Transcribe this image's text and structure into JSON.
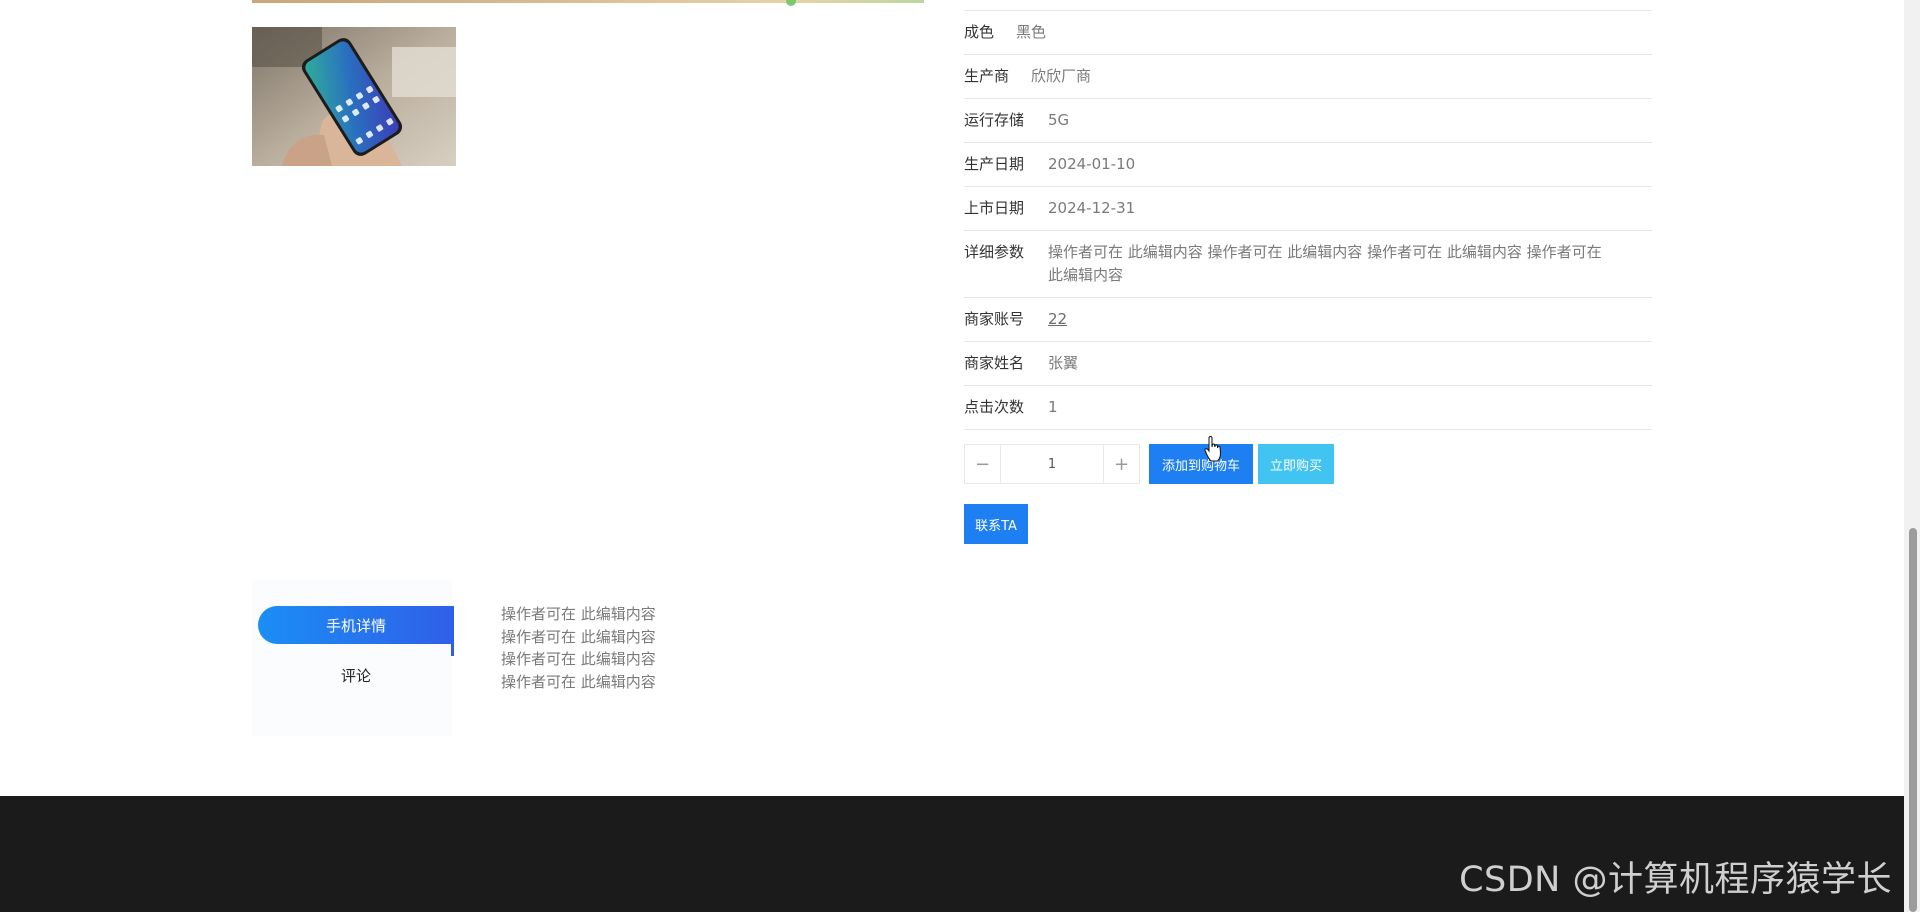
{
  "details": [
    {
      "label": "成色",
      "value": "黑色"
    },
    {
      "label": "生产商",
      "value": "欣欣厂商"
    },
    {
      "label": "运行存储",
      "value": "5G"
    },
    {
      "label": "生产日期",
      "value": "2024-01-10"
    },
    {
      "label": "上市日期",
      "value": "2024-12-31"
    },
    {
      "label": "详细参数",
      "value_line1": "操作者可在 此编辑内容 操作者可在 此编辑内容 操作者可在 此编辑内容 操作者可在",
      "value_line2": "此编辑内容"
    },
    {
      "label": "商家账号",
      "value": "22"
    },
    {
      "label": "商家姓名",
      "value": "张翼"
    },
    {
      "label": "点击次数",
      "value": "1"
    }
  ],
  "quantity": {
    "value": "1",
    "minus": "−",
    "plus": "+"
  },
  "buttons": {
    "add_to_cart": "添加到购物车",
    "buy_now": "立即购买",
    "contact": "联系TA"
  },
  "tabs": {
    "active": "手机详情",
    "inactive": "评论"
  },
  "tab_content": [
    "操作者可在 此编辑内容",
    "操作者可在 此编辑内容",
    "操作者可在 此编辑内容",
    "操作者可在 此编辑内容"
  ],
  "footer": {
    "watermark": "CSDN @计算机程序猿学长"
  },
  "colors": {
    "primary": "#1d7ff2",
    "secondary": "#42c4f2",
    "footer": "#1b1b1b"
  }
}
